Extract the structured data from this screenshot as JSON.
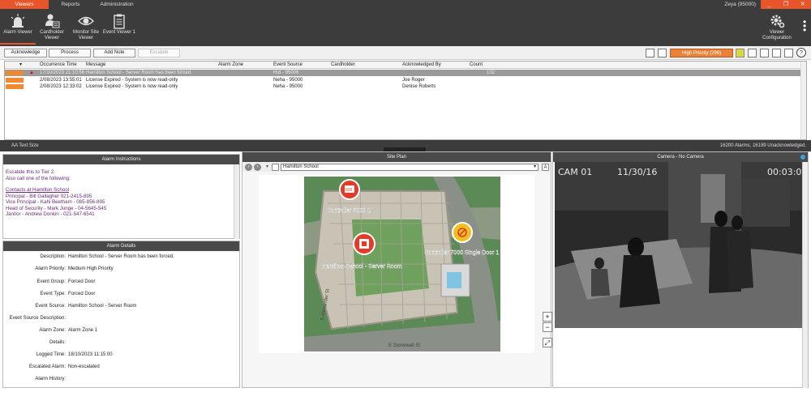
{
  "titlebar": {
    "tabs": [
      "Viewers",
      "Reports",
      "Administration"
    ],
    "user": "Zeya (95000)",
    "win_buttons": [
      "_",
      "❐",
      "✕"
    ]
  },
  "toolbar": {
    "tools": [
      "Alarm Viewer",
      "Cardholder Viewer",
      "Monitor Site Viewer",
      "Event Viewer 1"
    ],
    "config": "Viewer Configuration"
  },
  "actions": {
    "acknowledge": "Acknowledge",
    "process": "Process",
    "add_note": "Add Note",
    "escalate": "Escalate",
    "priority": "High Priority (296)",
    "help": "?"
  },
  "grid": {
    "columns": [
      "Occurrence Time",
      "Message",
      "Alarm Zone",
      "Event Source",
      "Cardholder",
      "Acknowledged By",
      "Count"
    ],
    "rows": [
      {
        "time": "17/10/2023 21:10:56",
        "message": "Hamilton School - Server Room has been forced.",
        "zone": "",
        "source": "Hut - 95006",
        "cardholder": "",
        "ack": "",
        "count": "132"
      },
      {
        "time": "2/08/2023 13:55:01",
        "message": "License Expired - System is now read-only",
        "zone": "",
        "source": "Neha - 95000",
        "cardholder": "",
        "ack": "Joe Roger",
        "count": ""
      },
      {
        "time": "2/08/2023 12:33:02",
        "message": "License Expired - System is now read-only",
        "zone": "",
        "source": "Neha - 95000",
        "cardholder": "",
        "ack": "Denise Roberts",
        "count": ""
      }
    ]
  },
  "status": {
    "text_size": "Text Size",
    "counts": "16200 Alarms, 16199 Unacknowledged."
  },
  "instructions": {
    "title": "Alarm Instructions",
    "line1": "Escalate this to Tier 2.",
    "line2": "Also call one of the following:",
    "contacts_title": "Contacts at Hamilton School",
    "contacts": [
      "Principal - Bill Gallagher 021-2415-895",
      "Vice Principal - Kahi Beetham - 085-856-895",
      "Head of Security - Mark Junge - 04-5645-545",
      "Janitor - Andrew Donkin - 021-547-6541"
    ]
  },
  "details": {
    "title": "Alarm Details",
    "rows": [
      {
        "label": "Description:",
        "value": "Hamilton School - Server Room has been forced."
      },
      {
        "label": "Alarm Priority:",
        "value": "Medium High Priority"
      },
      {
        "label": "Event Group:",
        "value": "Forced Door"
      },
      {
        "label": "Event Type:",
        "value": "Forced Door"
      },
      {
        "label": "Event Source:",
        "value": "Hamilton School - Server Room"
      },
      {
        "label": "Event Source Description:",
        "value": ""
      },
      {
        "label": "Alarm Zone:",
        "value": "Alarm Zone 1"
      },
      {
        "label": "Details:",
        "value": ""
      },
      {
        "label": "Logged Time:",
        "value": "18/10/2023 11:15:00"
      },
      {
        "label": "Escalated Alarm:",
        "value": "Non-escalated"
      },
      {
        "label": "Alarm History:",
        "value": ""
      }
    ]
  },
  "siteplan": {
    "title": "Site Plan",
    "selected": "Hamilton School",
    "labels": [
      "Controller 6000 1",
      "Hamilton School - Server Room",
      "Controller 7000 Single Door 1"
    ],
    "streets": [
      "E Stonewall St",
      "S Alexander St"
    ],
    "zoom_in": "+",
    "zoom_out": "−"
  },
  "camera": {
    "title": "Camera - No Camera",
    "cam_id": "CAM 01",
    "date": "11/30/16",
    "time": "00:03:05"
  },
  "colors": {
    "accent": "#e8552a",
    "dark": "#3c3c3c",
    "priority_orange": "#f08a30",
    "instruction_purple": "#6a2a7a"
  }
}
